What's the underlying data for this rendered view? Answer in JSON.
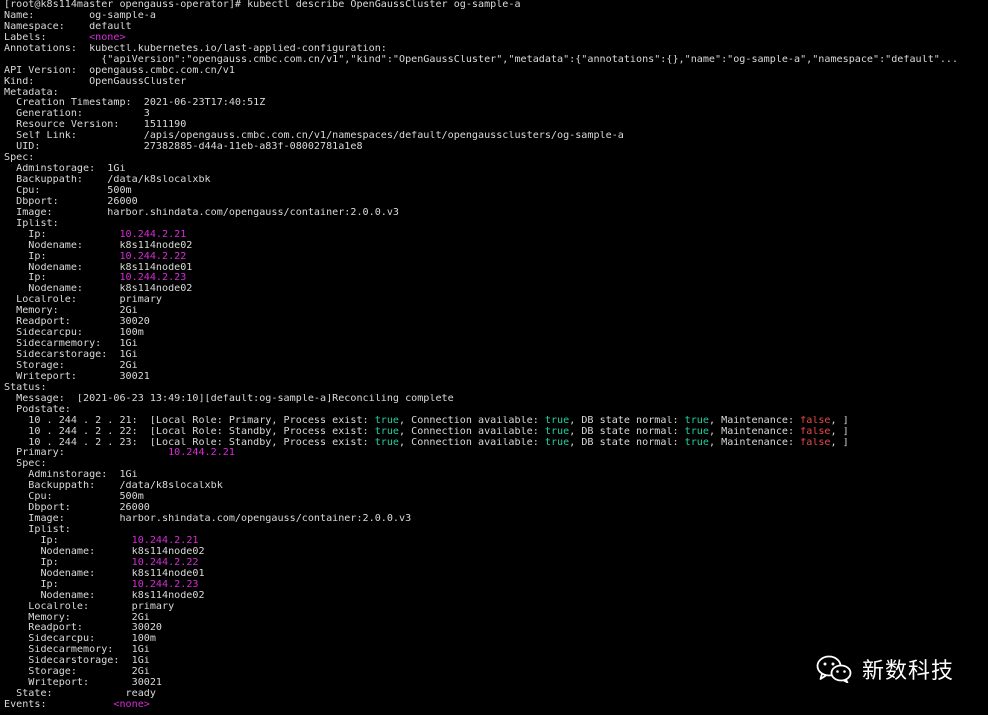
{
  "watermark": {
    "text": "新数科技",
    "icon": "wechat-icon"
  },
  "colors": {
    "background": "#000000",
    "text": "#d9d9d9",
    "magenta": "#d62bd6",
    "green": "#1fd1a0",
    "red": "#e24b4b"
  },
  "lines": [
    [
      {
        "t": "[root@k8s114master opengauss-operator]# kubectl describe OpenGaussCluster og-sample-a"
      }
    ],
    [
      {
        "t": "Name:         og-sample-a"
      }
    ],
    [
      {
        "t": "Namespace:    default"
      }
    ],
    [
      {
        "t": "Labels:       "
      },
      {
        "t": "<none>",
        "c": "magenta"
      }
    ],
    [
      {
        "t": "Annotations:  kubectl.kubernetes.io/last-applied-configuration:"
      }
    ],
    [
      {
        "t": "                {\"apiVersion\":\"opengauss.cmbc.com.cn/v1\",\"kind\":\"OpenGaussCluster\",\"metadata\":{\"annotations\":{},\"name\":\"og-sample-a\",\"namespace\":\"default\"..."
      }
    ],
    [
      {
        "t": "API Version:  opengauss.cmbc.com.cn/v1"
      }
    ],
    [
      {
        "t": "Kind:         OpenGaussCluster"
      }
    ],
    [
      {
        "t": "Metadata:"
      }
    ],
    [
      {
        "t": "  Creation Timestamp:  2021-06-23T17:40:51Z"
      }
    ],
    [
      {
        "t": "  Generation:          3"
      }
    ],
    [
      {
        "t": "  Resource Version:    1511190"
      }
    ],
    [
      {
        "t": "  Self Link:           /apis/opengauss.cmbc.com.cn/v1/namespaces/default/opengaussclusters/og-sample-a"
      }
    ],
    [
      {
        "t": "  UID:                 27382885-d44a-11eb-a83f-08002781a1e8"
      }
    ],
    [
      {
        "t": "Spec:"
      }
    ],
    [
      {
        "t": "  Adminstorage:  1Gi"
      }
    ],
    [
      {
        "t": "  Backuppath:    /data/k8slocalxbk"
      }
    ],
    [
      {
        "t": "  Cpu:           500m"
      }
    ],
    [
      {
        "t": "  Dbport:        26000"
      }
    ],
    [
      {
        "t": "  Image:         harbor.shindata.com/opengauss/container:2.0.0.v3"
      }
    ],
    [
      {
        "t": "  Iplist:"
      }
    ],
    [
      {
        "t": "    Ip:            "
      },
      {
        "t": "10.244.2.21",
        "c": "magenta"
      }
    ],
    [
      {
        "t": "    Nodename:      k8s114node02"
      }
    ],
    [
      {
        "t": "    Ip:            "
      },
      {
        "t": "10.244.2.22",
        "c": "magenta"
      }
    ],
    [
      {
        "t": "    Nodename:      k8s114node01"
      }
    ],
    [
      {
        "t": "    Ip:            "
      },
      {
        "t": "10.244.2.23",
        "c": "magenta"
      }
    ],
    [
      {
        "t": "    Nodename:      k8s114node02"
      }
    ],
    [
      {
        "t": "  Localrole:       primary"
      }
    ],
    [
      {
        "t": "  Memory:          2Gi"
      }
    ],
    [
      {
        "t": "  Readport:        30020"
      }
    ],
    [
      {
        "t": "  Sidecarcpu:      100m"
      }
    ],
    [
      {
        "t": "  Sidecarmemory:   1Gi"
      }
    ],
    [
      {
        "t": "  Sidecarstorage:  1Gi"
      }
    ],
    [
      {
        "t": "  Storage:         2Gi"
      }
    ],
    [
      {
        "t": "  Writeport:       30021"
      }
    ],
    [
      {
        "t": "Status:"
      }
    ],
    [
      {
        "t": "  Message:  [2021-06-23 13:49:10][default:og-sample-a]Reconciling complete"
      }
    ],
    [
      {
        "t": "  Podstate:"
      }
    ],
    [
      {
        "t": "    10 . 244 . 2 . 21:  [Local Role: Primary, Process exist: "
      },
      {
        "t": "true",
        "c": "green"
      },
      {
        "t": ", Connection available: "
      },
      {
        "t": "true",
        "c": "green"
      },
      {
        "t": ", DB state normal: "
      },
      {
        "t": "true",
        "c": "green"
      },
      {
        "t": ", Maintenance: "
      },
      {
        "t": "false",
        "c": "red"
      },
      {
        "t": ", ]"
      }
    ],
    [
      {
        "t": "    10 . 244 . 2 . 22:  [Local Role: Standby, Process exist: "
      },
      {
        "t": "true",
        "c": "green"
      },
      {
        "t": ", Connection available: "
      },
      {
        "t": "true",
        "c": "green"
      },
      {
        "t": ", DB state normal: "
      },
      {
        "t": "true",
        "c": "green"
      },
      {
        "t": ", Maintenance: "
      },
      {
        "t": "false",
        "c": "red"
      },
      {
        "t": ", ]"
      }
    ],
    [
      {
        "t": "    10 . 244 . 2 . 23:  [Local Role: Standby, Process exist: "
      },
      {
        "t": "true",
        "c": "green"
      },
      {
        "t": ", Connection available: "
      },
      {
        "t": "true",
        "c": "green"
      },
      {
        "t": ", DB state normal: "
      },
      {
        "t": "true",
        "c": "green"
      },
      {
        "t": ", Maintenance: "
      },
      {
        "t": "false",
        "c": "red"
      },
      {
        "t": ", ]"
      }
    ],
    [
      {
        "t": "  Primary:                 "
      },
      {
        "t": "10.244.2.21",
        "c": "magenta"
      }
    ],
    [
      {
        "t": "  Spec:"
      }
    ],
    [
      {
        "t": "    Adminstorage:  1Gi"
      }
    ],
    [
      {
        "t": "    Backuppath:    /data/k8slocalxbk"
      }
    ],
    [
      {
        "t": "    Cpu:           500m"
      }
    ],
    [
      {
        "t": "    Dbport:        26000"
      }
    ],
    [
      {
        "t": "    Image:         harbor.shindata.com/opengauss/container:2.0.0.v3"
      }
    ],
    [
      {
        "t": "    Iplist:"
      }
    ],
    [
      {
        "t": "      Ip:            "
      },
      {
        "t": "10.244.2.21",
        "c": "magenta"
      }
    ],
    [
      {
        "t": "      Nodename:      k8s114node02"
      }
    ],
    [
      {
        "t": "      Ip:            "
      },
      {
        "t": "10.244.2.22",
        "c": "magenta"
      }
    ],
    [
      {
        "t": "      Nodename:      k8s114node01"
      }
    ],
    [
      {
        "t": "      Ip:            "
      },
      {
        "t": "10.244.2.23",
        "c": "magenta"
      }
    ],
    [
      {
        "t": "      Nodename:      k8s114node02"
      }
    ],
    [
      {
        "t": "    Localrole:       primary"
      }
    ],
    [
      {
        "t": "    Memory:          2Gi"
      }
    ],
    [
      {
        "t": "    Readport:        30020"
      }
    ],
    [
      {
        "t": "    Sidecarcpu:      100m"
      }
    ],
    [
      {
        "t": "    Sidecarmemory:   1Gi"
      }
    ],
    [
      {
        "t": "    Sidecarstorage:  1Gi"
      }
    ],
    [
      {
        "t": "    Storage:         2Gi"
      }
    ],
    [
      {
        "t": "    Writeport:       30021"
      }
    ],
    [
      {
        "t": "  State:            ready"
      }
    ],
    [
      {
        "t": "Events:           "
      },
      {
        "t": "<none>",
        "c": "magenta"
      }
    ]
  ]
}
